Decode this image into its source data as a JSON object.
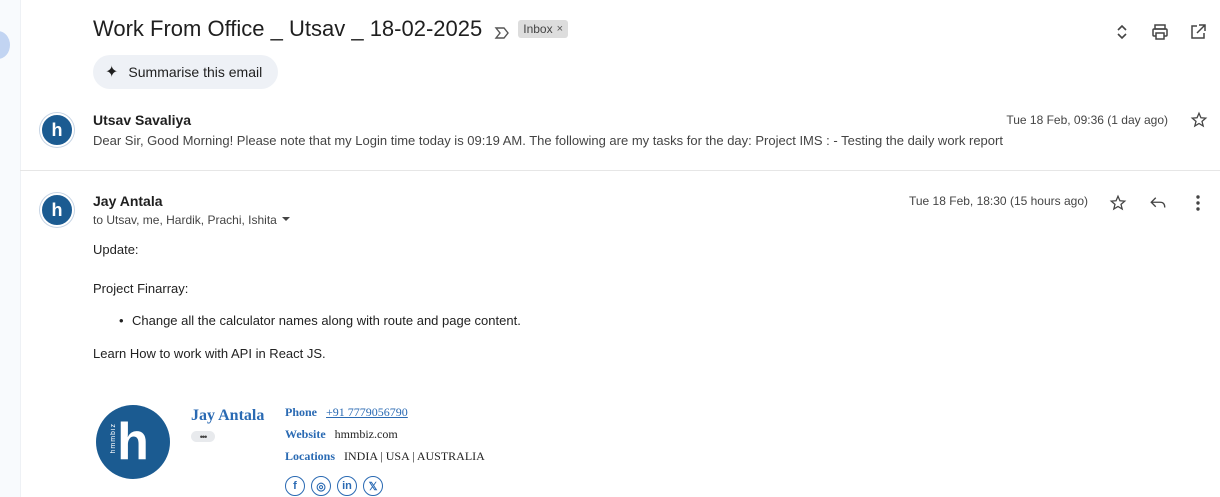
{
  "thread": {
    "subject": "Work From Office _ Utsav _ 18-02-2025",
    "label": "Inbox",
    "label_close": "×",
    "summarise_label": "Summarise this email"
  },
  "message1": {
    "sender": "Utsav Savaliya",
    "snippet": "Dear Sir, Good Morning! Please note that my Login time today is 09:19 AM. The following are my tasks for the day: Project IMS : - Testing the daily work report",
    "date": "Tue 18 Feb, 09:36 (1 day ago)",
    "avatar_letter": "h"
  },
  "message2": {
    "sender": "Jay Antala",
    "to": "to Utsav, me, Hardik, Prachi, Ishita",
    "date": "Tue 18 Feb, 18:30 (15 hours ago)",
    "avatar_letter": "h",
    "body": {
      "line1": "Update:",
      "line2": "Project Finarray:",
      "bullet1": "Change all the calculator names along with route and page content.",
      "line3": "Learn How to work with API in React JS."
    }
  },
  "signature": {
    "logo_letter": "h",
    "logo_small_text": "hmmbiz",
    "name": "Jay Antala",
    "more": "•••",
    "phone_label": "Phone",
    "phone": "+91 7779056790",
    "website_label": "Website",
    "website": "hmmbiz.com",
    "locations_label": "Locations",
    "locations": "INDIA | USA | AUSTRALIA",
    "socials": [
      "f",
      "◎",
      "in",
      "𝕏"
    ]
  },
  "colors": {
    "brand_blue": "#1b5b91",
    "link_blue": "#2a6ab3"
  }
}
